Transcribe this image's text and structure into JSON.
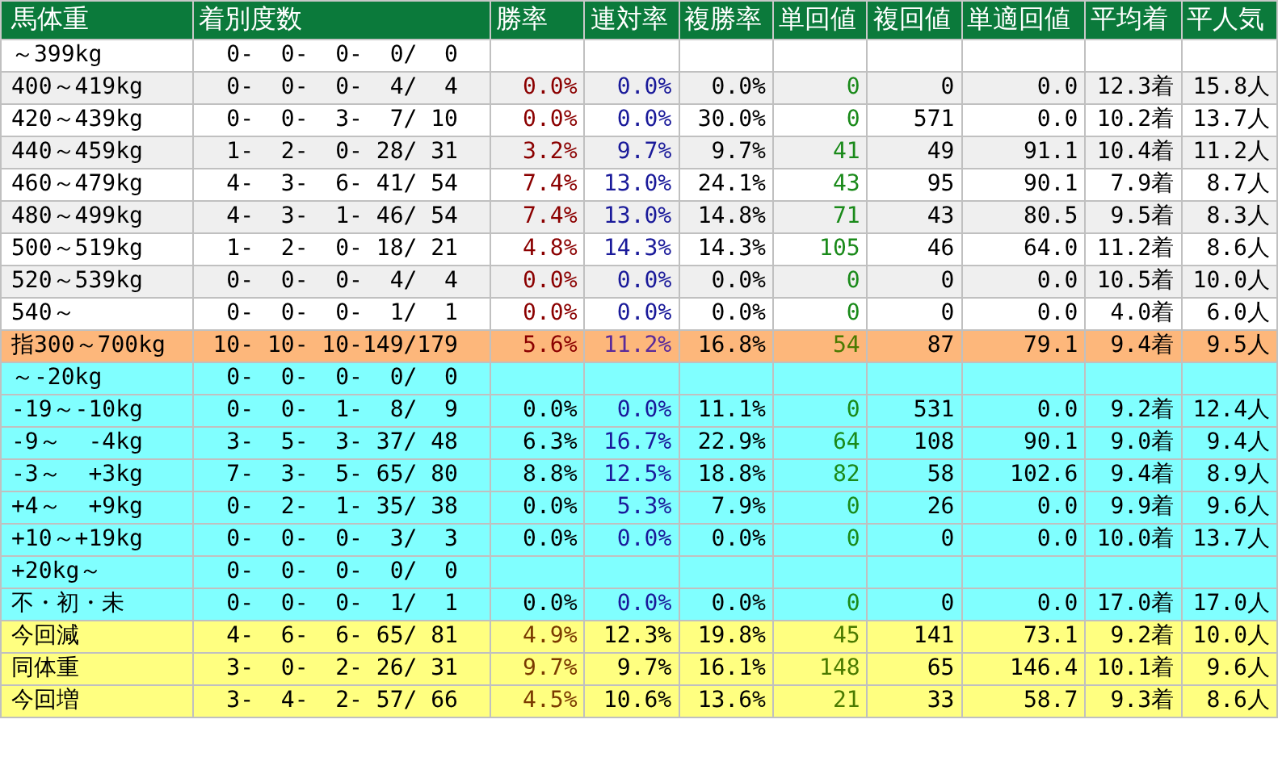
{
  "columns": [
    "馬体重",
    "着別度数",
    "勝率",
    "連対率",
    "複勝率",
    "単回値",
    "複回値",
    "単適回値",
    "平均着",
    "平人気"
  ],
  "rows": [
    {
      "kind": "plain",
      "label": "～399kg",
      "record": " 0-  0-  0-  0/  0"
    },
    {
      "kind": "plain",
      "label": "400～419kg",
      "record": " 0-  0-  0-  4/  4",
      "stats": [
        "0.0%",
        "0.0%",
        "0.0%",
        "0",
        "0",
        "0.0",
        "12.3着",
        "15.8人"
      ]
    },
    {
      "kind": "plain",
      "label": "420～439kg",
      "record": " 0-  0-  3-  7/ 10",
      "stats": [
        "0.0%",
        "0.0%",
        "30.0%",
        "0",
        "571",
        "0.0",
        "10.2着",
        "13.7人"
      ]
    },
    {
      "kind": "plain",
      "label": "440～459kg",
      "record": " 1-  2-  0- 28/ 31",
      "stats": [
        "3.2%",
        "9.7%",
        "9.7%",
        "41",
        "49",
        "91.1",
        "10.4着",
        "11.2人"
      ]
    },
    {
      "kind": "plain",
      "label": "460～479kg",
      "record": " 4-  3-  6- 41/ 54",
      "stats": [
        "7.4%",
        "13.0%",
        "24.1%",
        "43",
        "95",
        "90.1",
        "7.9着",
        "8.7人"
      ]
    },
    {
      "kind": "plain",
      "label": "480～499kg",
      "record": " 4-  3-  1- 46/ 54",
      "stats": [
        "7.4%",
        "13.0%",
        "14.8%",
        "71",
        "43",
        "80.5",
        "9.5着",
        "8.3人"
      ]
    },
    {
      "kind": "plain",
      "label": "500～519kg",
      "record": " 1-  2-  0- 18/ 21",
      "stats": [
        "4.8%",
        "14.3%",
        "14.3%",
        "105",
        "46",
        "64.0",
        "11.2着",
        "8.6人"
      ]
    },
    {
      "kind": "plain",
      "label": "520～539kg",
      "record": " 0-  0-  0-  4/  4",
      "stats": [
        "0.0%",
        "0.0%",
        "0.0%",
        "0",
        "0",
        "0.0",
        "10.5着",
        "10.0人"
      ]
    },
    {
      "kind": "plain",
      "label": "540～",
      "record": " 0-  0-  0-  1/  1",
      "stats": [
        "0.0%",
        "0.0%",
        "0.0%",
        "0",
        "0",
        "0.0",
        "4.0着",
        "6.0人"
      ]
    },
    {
      "kind": "total",
      "label": "指300～700kg",
      "record": "10- 10- 10-149/179",
      "stats": [
        "5.6%",
        "11.2%",
        "16.8%",
        "54",
        "87",
        "79.1",
        "9.4着",
        "9.5人"
      ]
    },
    {
      "kind": "diff",
      "label": "～-20kg",
      "record": " 0-  0-  0-  0/  0"
    },
    {
      "kind": "diff",
      "label": "-19～-10kg",
      "record": " 0-  0-  1-  8/  9",
      "stats": [
        "0.0%",
        "0.0%",
        "11.1%",
        "0",
        "531",
        "0.0",
        "9.2着",
        "12.4人"
      ]
    },
    {
      "kind": "diff",
      "label": "-9～  -4kg",
      "record": " 3-  5-  3- 37/ 48",
      "stats": [
        "6.3%",
        "16.7%",
        "22.9%",
        "64",
        "108",
        "90.1",
        "9.0着",
        "9.4人"
      ]
    },
    {
      "kind": "diff",
      "label": "-3～  +3kg",
      "record": " 7-  3-  5- 65/ 80",
      "stats": [
        "8.8%",
        "12.5%",
        "18.8%",
        "82",
        "58",
        "102.6",
        "9.4着",
        "8.9人"
      ]
    },
    {
      "kind": "diff",
      "label": "+4～  +9kg",
      "record": " 0-  2-  1- 35/ 38",
      "stats": [
        "0.0%",
        "5.3%",
        "7.9%",
        "0",
        "26",
        "0.0",
        "9.9着",
        "9.6人"
      ]
    },
    {
      "kind": "diff",
      "label": "+10～+19kg",
      "record": " 0-  0-  0-  3/  3",
      "stats": [
        "0.0%",
        "0.0%",
        "0.0%",
        "0",
        "0",
        "0.0",
        "10.0着",
        "13.7人"
      ]
    },
    {
      "kind": "diff",
      "label": "+20kg～",
      "record": " 0-  0-  0-  0/  0"
    },
    {
      "kind": "diff",
      "label": "不・初・未",
      "record": " 0-  0-  0-  1/  1",
      "stats": [
        "0.0%",
        "0.0%",
        "0.0%",
        "0",
        "0",
        "0.0",
        "17.0着",
        "17.0人"
      ]
    },
    {
      "kind": "summary",
      "label": "今回減",
      "record": " 4-  6-  6- 65/ 81",
      "stats": [
        "4.9%",
        "12.3%",
        "19.8%",
        "45",
        "141",
        "73.1",
        "9.2着",
        "10.0人"
      ]
    },
    {
      "kind": "summary",
      "label": "同体重",
      "record": " 3-  0-  2- 26/ 31",
      "stats": [
        "9.7%",
        "9.7%",
        "16.1%",
        "148",
        "65",
        "146.4",
        "10.1着",
        "9.6人"
      ]
    },
    {
      "kind": "summary",
      "label": "今回増",
      "record": " 3-  4-  2- 57/ 66",
      "stats": [
        "4.5%",
        "10.6%",
        "13.6%",
        "21",
        "33",
        "58.7",
        "9.3着",
        "8.6人"
      ]
    }
  ]
}
